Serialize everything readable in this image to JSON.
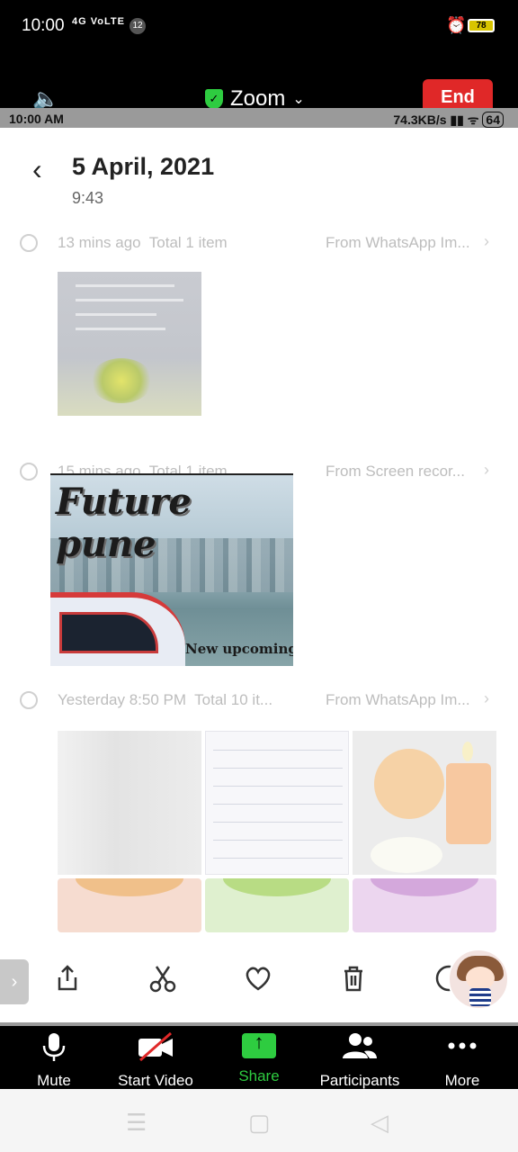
{
  "status_bar": {
    "time": "10:00",
    "network": "4G VoLTE",
    "notification_count": "12",
    "battery": "78",
    "alarm_icon": "alarm-clock-icon"
  },
  "zoom_top": {
    "title": "Zoom",
    "end_label": "End",
    "shield_color": "#2ecc40",
    "end_color": "#e02828"
  },
  "shared_status": {
    "time": "10:00 AM",
    "speed": "74.3KB/s",
    "battery": "64"
  },
  "header": {
    "title": "5 April, 2021",
    "subtitle": "9:43"
  },
  "groups": [
    {
      "ago": "13 mins ago",
      "total": "Total 1 item",
      "source": "From WhatsApp Im..."
    },
    {
      "ago": "15 mins ago",
      "total": "Total 1 item",
      "source": "From Screen recor..."
    },
    {
      "ago": "Yesterday 8:50 PM",
      "total": "Total 10 it...",
      "source": "From WhatsApp Im..."
    }
  ],
  "video_thumbnail": {
    "title": "Future pune",
    "caption": "New upcoming p"
  },
  "actions": [
    "share-icon",
    "scissors-icon",
    "heart-icon",
    "trash-icon",
    "more-circle-icon"
  ],
  "zoom_bottom": {
    "mute": "Mute",
    "start_video": "Start Video",
    "share": "Share",
    "participants": "Participants",
    "more": "More",
    "share_color": "#2ecc40"
  }
}
